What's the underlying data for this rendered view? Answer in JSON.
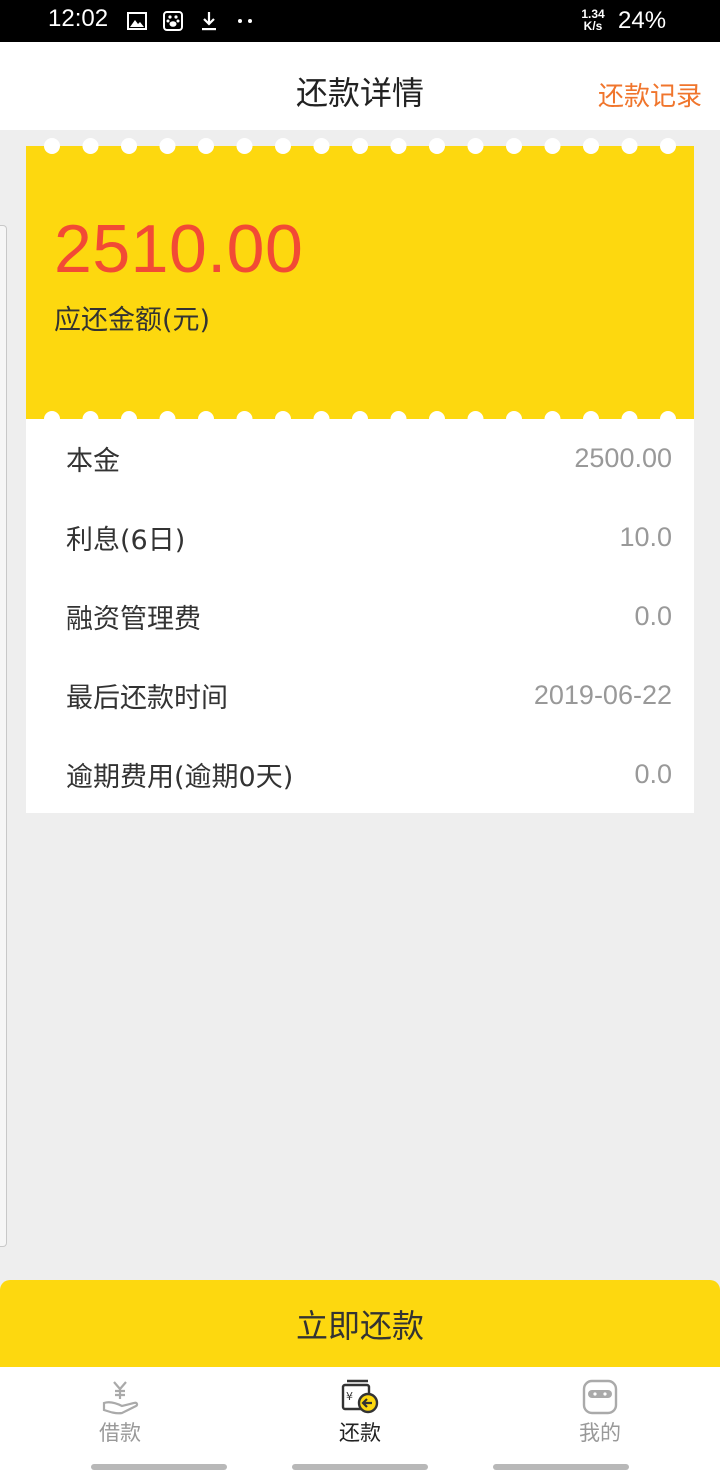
{
  "status_bar": {
    "time": "12:02",
    "icons": [
      "image-icon",
      "baidu-paw-icon",
      "download-icon",
      "more-dots-icon"
    ],
    "net_speed_value": "1.34",
    "net_speed_unit": "K/s",
    "battery": "24%"
  },
  "header": {
    "title": "还款详情",
    "records_link": "还款记录"
  },
  "summary": {
    "amount": "2510.00",
    "amount_label": "应还金额(元)"
  },
  "details": [
    {
      "label": "本金",
      "value": "2500.00"
    },
    {
      "label": "利息(6日)",
      "value": "10.0"
    },
    {
      "label": "融资管理费",
      "value": "0.0"
    },
    {
      "label": "最后还款时间",
      "value": "2019-06-22"
    },
    {
      "label": "逾期费用(逾期0天)",
      "value": "0.0"
    }
  ],
  "pay_button": "立即还款",
  "tabs": [
    {
      "label": "借款",
      "icon": "borrow-yen-hand-icon",
      "active": false
    },
    {
      "label": "还款",
      "icon": "repay-wallet-icon",
      "active": true
    },
    {
      "label": "我的",
      "icon": "profile-mask-icon",
      "active": false
    }
  ],
  "colors": {
    "accent_yellow": "#fdd80f",
    "amount_red": "#f24a35",
    "link_orange": "#f0752c"
  }
}
